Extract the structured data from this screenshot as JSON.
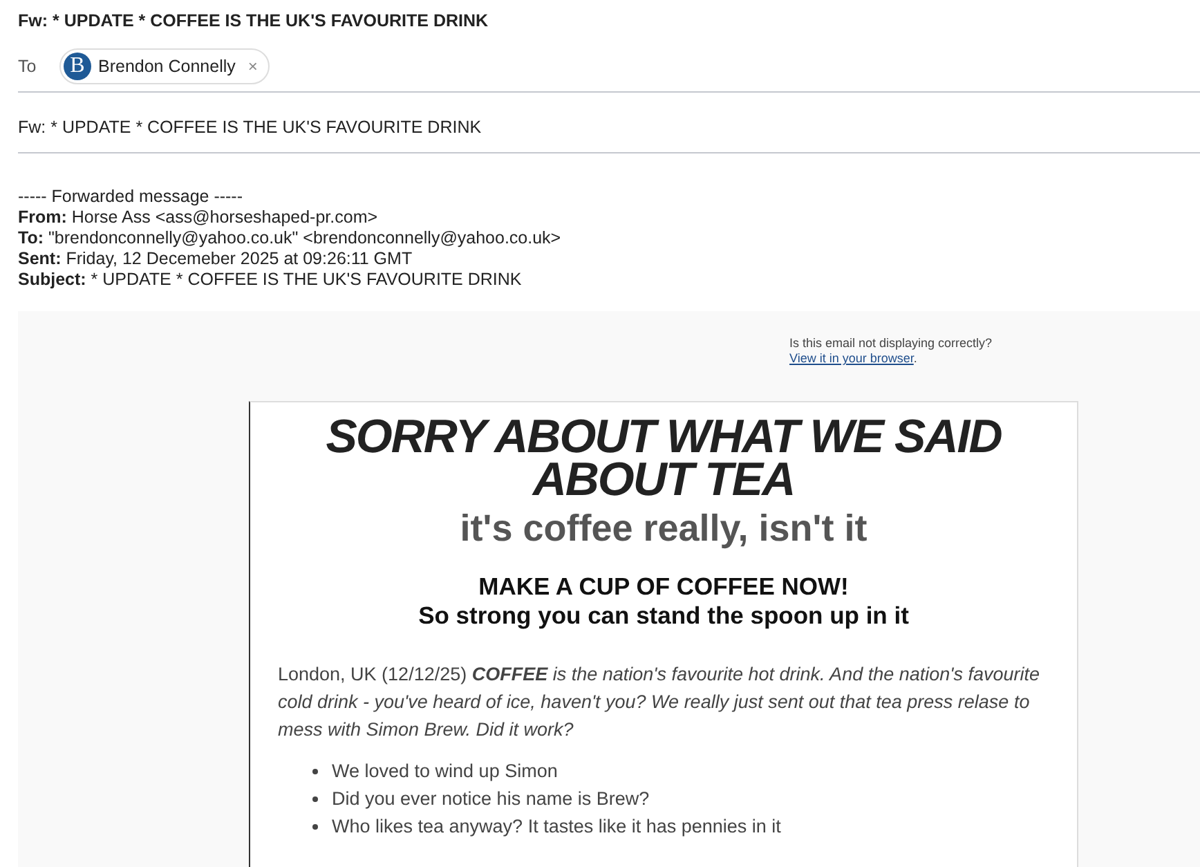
{
  "title": "Fw: * UPDATE * COFFEE IS THE UK'S FAVOURITE DRINK",
  "to": {
    "label": "To",
    "recipients": [
      {
        "initial": "B",
        "name": "Brendon Connelly",
        "remove": "×"
      }
    ]
  },
  "subject": "Fw: * UPDATE * COFFEE IS THE UK'S FAVOURITE DRINK",
  "forwarded": {
    "heading": "----- Forwarded message -----",
    "lines": [
      "**From:** Horse Ass <ass@horseshaped-pr.com>",
      "**To:** \"brendonconnelly@yahoo.co.uk\" <brendonconnelly@yahoo.co.uk>",
      "**Sent:** Friday, 12 Decemeber 2025 at 09:26:11 GMT",
      "**Subject:** * UPDATE * COFFEE IS THE UK'S FAVOURITE DRINK"
    ]
  },
  "email": {
    "display_note": "Is this email not displaying correctly?",
    "browser_link": "View it in your browser",
    "link_end": ".",
    "headline": "SORRY ABOUT WHAT WE SAID ABOUT TEA",
    "subheadline": "it's coffee really, isn't it",
    "callout": [
      "MAKE A CUP OF COFFEE NOW!",
      "So strong you can stand the spoon up in it"
    ],
    "paragraph": {
      "lead": "London, UK (12/12/25)",
      "story": "**COFFEE** is the nation's favourite hot drink. And the nation's favourite cold drink - you've heard of ice, haven't you? We really just sent out that tea press relase to mess with Simon Brew. Did it work?"
    },
    "bullets": [
      "We loved to wind up Simon",
      "Did you ever notice his name is Brew?",
      "Who likes tea anyway? It tastes like it has pennies in it"
    ]
  }
}
